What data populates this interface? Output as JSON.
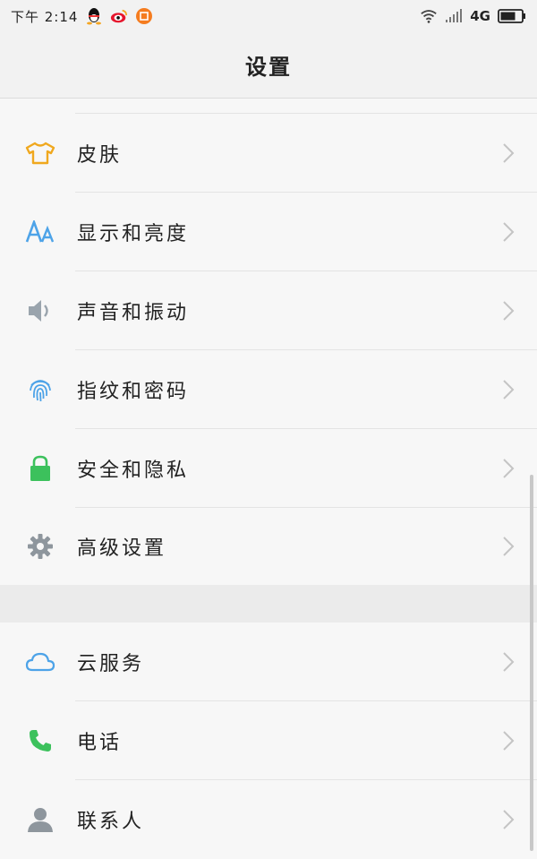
{
  "status_bar": {
    "time": "下午 2:14",
    "network": "4G",
    "icons": [
      "qq-icon",
      "weibo-icon",
      "app-notification-icon",
      "wifi-icon",
      "signal-icon",
      "battery-icon"
    ]
  },
  "header": {
    "title": "设置"
  },
  "settings": {
    "group1": [
      {
        "label": "皮肤",
        "icon": "shirt-icon",
        "color": "#f0a81e"
      },
      {
        "label": "显示和亮度",
        "icon": "font-aa-icon",
        "color": "#4da3e8"
      },
      {
        "label": "声音和振动",
        "icon": "speaker-icon",
        "color": "#9aa4ad"
      },
      {
        "label": "指纹和密码",
        "icon": "fingerprint-icon",
        "color": "#4da3e8"
      },
      {
        "label": "安全和隐私",
        "icon": "lock-icon",
        "color": "#3cc15c"
      },
      {
        "label": "高级设置",
        "icon": "gear-icon",
        "color": "#8e969d"
      }
    ],
    "group2": [
      {
        "label": "云服务",
        "icon": "cloud-icon",
        "color": "#4da3e8"
      },
      {
        "label": "电话",
        "icon": "phone-icon",
        "color": "#3cc15c"
      },
      {
        "label": "联系人",
        "icon": "contact-icon",
        "color": "#8e969d"
      }
    ]
  }
}
